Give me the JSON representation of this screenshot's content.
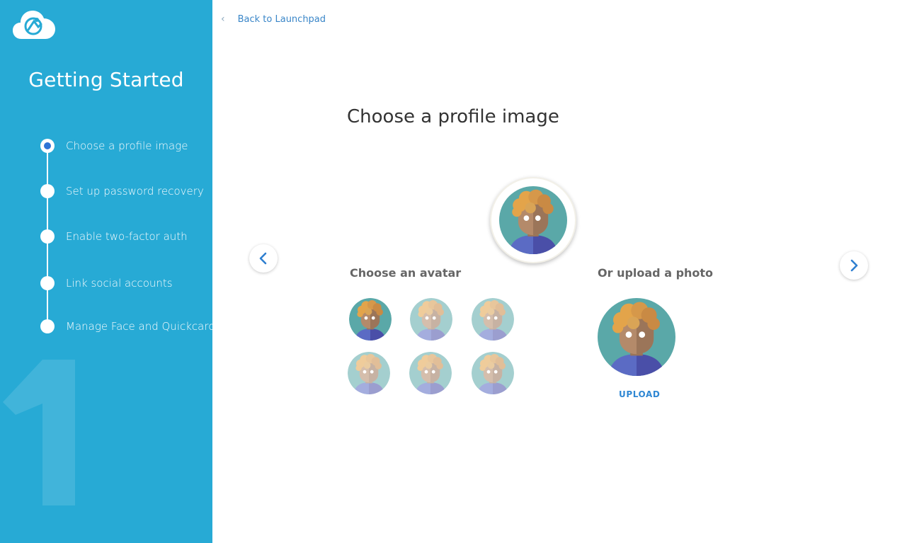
{
  "sidebar": {
    "title": "Getting Started",
    "big_number": "1",
    "steps": [
      {
        "label": "Choose a profile image",
        "active": true
      },
      {
        "label": "Set up password recovery",
        "active": false
      },
      {
        "label": "Enable two-factor auth",
        "active": false
      },
      {
        "label": "Link social accounts",
        "active": false
      },
      {
        "label": "Manage Face and Quickcard",
        "active": false
      }
    ]
  },
  "header": {
    "back_label": "Back to Launchpad"
  },
  "main": {
    "title": "Choose a profile image",
    "avatar_section_label": "Choose an avatar",
    "upload_section_label": "Or upload a photo",
    "upload_button_label": "UPLOAD"
  },
  "icons": {
    "logo": "cloud-logo-icon",
    "prev": "chevron-left-icon",
    "next": "chevron-right-icon",
    "back": "chevron-left-icon"
  },
  "colors": {
    "sidebar_bg": "#27aad5",
    "accent": "#2e74d6",
    "link": "#3a86c8",
    "avatar_bg": "#5aa8a8",
    "hair": "#e3a44a",
    "skin": "#b48a6a",
    "shirt": "#5b6bc4"
  }
}
